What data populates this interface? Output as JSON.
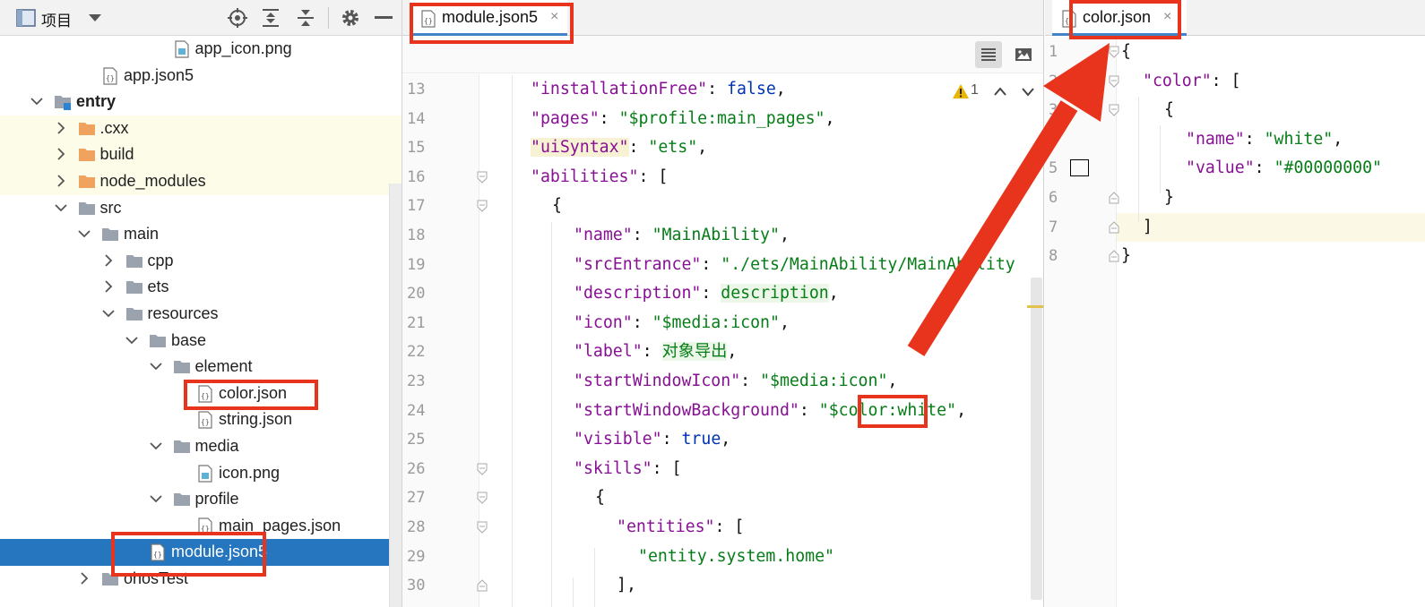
{
  "project_panel": {
    "title": "项目",
    "toolbar_icons": [
      "project-view-icon",
      "chevron-down-icon",
      "locate-icon",
      "expand-all-icon",
      "collapse-all-icon",
      "gear-icon",
      "minimize-icon"
    ],
    "tree": [
      {
        "label": "app_icon.png",
        "type": "image-file",
        "depth": 6,
        "expanded": null
      },
      {
        "label": "app.json5",
        "type": "json-file",
        "depth": 3,
        "expanded": null
      },
      {
        "label": "entry",
        "type": "module",
        "depth": 1,
        "expanded": true
      },
      {
        "label": ".cxx",
        "type": "orange-folder",
        "depth": 2,
        "expanded": false
      },
      {
        "label": "build",
        "type": "orange-folder",
        "depth": 2,
        "expanded": false
      },
      {
        "label": "node_modules",
        "type": "orange-folder",
        "depth": 2,
        "expanded": false
      },
      {
        "label": "src",
        "type": "folder",
        "depth": 2,
        "expanded": true
      },
      {
        "label": "main",
        "type": "folder",
        "depth": 3,
        "expanded": true
      },
      {
        "label": "cpp",
        "type": "folder",
        "depth": 4,
        "expanded": false
      },
      {
        "label": "ets",
        "type": "folder",
        "depth": 4,
        "expanded": false
      },
      {
        "label": "resources",
        "type": "folder",
        "depth": 4,
        "expanded": true
      },
      {
        "label": "base",
        "type": "folder",
        "depth": 5,
        "expanded": true
      },
      {
        "label": "element",
        "type": "folder",
        "depth": 6,
        "expanded": true
      },
      {
        "label": "color.json",
        "type": "json-file",
        "depth": 7,
        "expanded": null
      },
      {
        "label": "string.json",
        "type": "json-file",
        "depth": 7,
        "expanded": null
      },
      {
        "label": "media",
        "type": "folder",
        "depth": 6,
        "expanded": true
      },
      {
        "label": "icon.png",
        "type": "image-file",
        "depth": 7,
        "expanded": null
      },
      {
        "label": "profile",
        "type": "folder",
        "depth": 6,
        "expanded": true
      },
      {
        "label": "main_pages.json",
        "type": "json-file",
        "depth": 7,
        "expanded": null
      },
      {
        "label": "module.json5",
        "type": "json-file",
        "depth": 5,
        "expanded": null,
        "selected": true
      },
      {
        "label": "ohosTest",
        "type": "folder",
        "depth": 3,
        "expanded": false
      }
    ]
  },
  "left_editor": {
    "tab_label": "module.json5",
    "tab_close": "×",
    "warning_count": "1",
    "lines": [
      {
        "n": "13",
        "tokens": [
          [
            "k",
            "\"installationFree\""
          ],
          [
            "p",
            ": "
          ],
          [
            "kw",
            "false"
          ],
          [
            "p",
            ","
          ]
        ]
      },
      {
        "n": "14",
        "tokens": [
          [
            "k",
            "\"pages\""
          ],
          [
            "p",
            ": "
          ],
          [
            "s",
            "\"$profile:main_pages\""
          ],
          [
            "p",
            ","
          ]
        ]
      },
      {
        "n": "15",
        "tokens": [
          [
            "k",
            "\"uiSyntax\""
          ],
          [
            "p",
            ": "
          ],
          [
            "s",
            "\"ets\""
          ],
          [
            "p",
            ","
          ]
        ]
      },
      {
        "n": "16",
        "tokens": [
          [
            "k",
            "\"abilities\""
          ],
          [
            "p",
            ": ["
          ]
        ]
      },
      {
        "n": "17",
        "tokens": [
          [
            "p",
            "{"
          ]
        ]
      },
      {
        "n": "18",
        "tokens": [
          [
            "k",
            "\"name\""
          ],
          [
            "p",
            ": "
          ],
          [
            "s",
            "\"MainAbility\""
          ],
          [
            "p",
            ","
          ]
        ]
      },
      {
        "n": "19",
        "tokens": [
          [
            "k",
            "\"srcEntrance\""
          ],
          [
            "p",
            ": "
          ],
          [
            "s",
            "\"./ets/MainAbility/MainAbility"
          ]
        ]
      },
      {
        "n": "20",
        "tokens": [
          [
            "k",
            "\"description\""
          ],
          [
            "p",
            ": "
          ],
          [
            "s",
            "description"
          ],
          [
            "p",
            ","
          ]
        ]
      },
      {
        "n": "21",
        "tokens": [
          [
            "k",
            "\"icon\""
          ],
          [
            "p",
            ": "
          ],
          [
            "s",
            "\"$media:icon\""
          ],
          [
            "p",
            ","
          ]
        ]
      },
      {
        "n": "22",
        "tokens": [
          [
            "k",
            "\"label\""
          ],
          [
            "p",
            ": "
          ],
          [
            "cjk",
            "对象导出"
          ],
          [
            "p",
            ","
          ]
        ]
      },
      {
        "n": "23",
        "tokens": [
          [
            "k",
            "\"startWindowIcon\""
          ],
          [
            "p",
            ": "
          ],
          [
            "s",
            "\"$media:icon\""
          ],
          [
            "p",
            ","
          ]
        ]
      },
      {
        "n": "24",
        "tokens": [
          [
            "k",
            "\"startWindowBackground\""
          ],
          [
            "p",
            ": "
          ],
          [
            "s",
            "\"$color:white\""
          ],
          [
            "p",
            ","
          ]
        ]
      },
      {
        "n": "25",
        "tokens": [
          [
            "k",
            "\"visible\""
          ],
          [
            "p",
            ": "
          ],
          [
            "kw",
            "true"
          ],
          [
            "p",
            ","
          ]
        ]
      },
      {
        "n": "26",
        "tokens": [
          [
            "k",
            "\"skills\""
          ],
          [
            "p",
            ": ["
          ]
        ]
      },
      {
        "n": "27",
        "tokens": [
          [
            "p",
            "{"
          ]
        ]
      },
      {
        "n": "28",
        "tokens": [
          [
            "k",
            "\"entities\""
          ],
          [
            "p",
            ": ["
          ]
        ]
      },
      {
        "n": "29",
        "tokens": [
          [
            "s",
            "\"entity.system.home\""
          ]
        ]
      },
      {
        "n": "30",
        "tokens": [
          [
            "p",
            "],"
          ]
        ]
      }
    ]
  },
  "right_editor": {
    "tab_label": "color.json",
    "tab_close": "×",
    "swatch_color": "#00000000",
    "lines": [
      {
        "n": "1",
        "tokens": [
          [
            "p",
            "{"
          ]
        ]
      },
      {
        "n": "2",
        "tokens": [
          [
            "k",
            "\"color\""
          ],
          [
            "p",
            ": ["
          ]
        ]
      },
      {
        "n": "3",
        "tokens": [
          [
            "p",
            "{"
          ]
        ]
      },
      {
        "n": "4",
        "tokens": [
          [
            "k",
            "\"name\""
          ],
          [
            "p",
            ": "
          ],
          [
            "s",
            "\"white\""
          ],
          [
            "p",
            ","
          ]
        ]
      },
      {
        "n": "5",
        "tokens": [
          [
            "k",
            "\"value\""
          ],
          [
            "p",
            ": "
          ],
          [
            "s",
            "\"#00000000\""
          ]
        ]
      },
      {
        "n": "6",
        "tokens": [
          [
            "p",
            "}"
          ]
        ]
      },
      {
        "n": "7",
        "tokens": [
          [
            "p",
            "]"
          ]
        ]
      },
      {
        "n": "8",
        "tokens": [
          [
            "p",
            "}"
          ]
        ]
      }
    ]
  },
  "colors": {
    "annotation_red": "#e8341c",
    "selection_blue": "#2675bf",
    "json_key": "#871094",
    "json_string": "#067d17",
    "json_keyword": "#0033b3"
  }
}
